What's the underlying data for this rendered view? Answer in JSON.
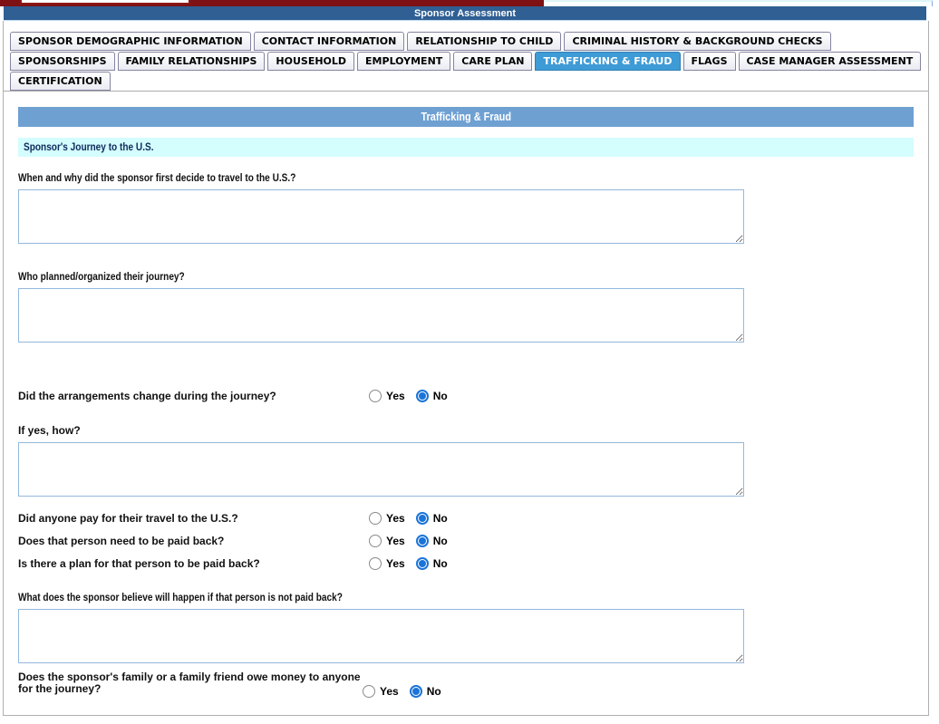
{
  "page": {
    "title": "Sponsor Assessment"
  },
  "tabs": {
    "rows": [
      [
        "SPONSOR DEMOGRAPHIC INFORMATION",
        "CONTACT INFORMATION",
        "RELATIONSHIP TO CHILD",
        "CRIMINAL HISTORY & BACKGROUND CHECKS"
      ],
      [
        "SPONSORSHIPS",
        "FAMILY RELATIONSHIPS",
        "HOUSEHOLD",
        "EMPLOYMENT",
        "CARE PLAN",
        "TRAFFICKING & FRAUD",
        "FLAGS",
        "CASE MANAGER ASSESSMENT"
      ],
      [
        "CERTIFICATION"
      ]
    ],
    "active_tab": "TRAFFICKING & FRAUD"
  },
  "section": {
    "title": "Trafficking & Fraud",
    "subtitle": "Sponsor's Journey to the U.S."
  },
  "questions": {
    "travel_decision": {
      "label": "When and why did the sponsor first decide to travel to the U.S.?",
      "value": ""
    },
    "planned_journey": {
      "label": "Who planned/organized their journey?",
      "value": ""
    },
    "arrangements_change": {
      "label": "Did the arrangements change during the journey?",
      "selected": "No"
    },
    "if_yes_how": {
      "label": "If yes, how?",
      "value": ""
    },
    "anyone_pay": {
      "label": "Did anyone pay for their travel to the U.S.?",
      "selected": "No"
    },
    "need_paid_back": {
      "label": "Does that person need to be paid back?",
      "selected": "No"
    },
    "plan_paid_back": {
      "label": "Is there a plan for that person to be paid back?",
      "selected": "No"
    },
    "not_paid_back_belief": {
      "label": "What does the sponsor believe will happen if that person is not paid back?",
      "value": ""
    },
    "family_owe": {
      "label": "Does the sponsor's family or a family friend owe money to anyone for the journey?",
      "selected": "No"
    }
  },
  "radio_options": {
    "yes": "Yes",
    "no": "No"
  },
  "colors": {
    "title_bar": "#2F5F93",
    "active_tab": "#3E9BD6",
    "section_header": "#6FA0D2",
    "subsection_bar": "#D4FDFE",
    "top_bar_red": "#7E1113",
    "textarea_border": "#94B8DD",
    "radio_selected": "#1B74D8"
  }
}
